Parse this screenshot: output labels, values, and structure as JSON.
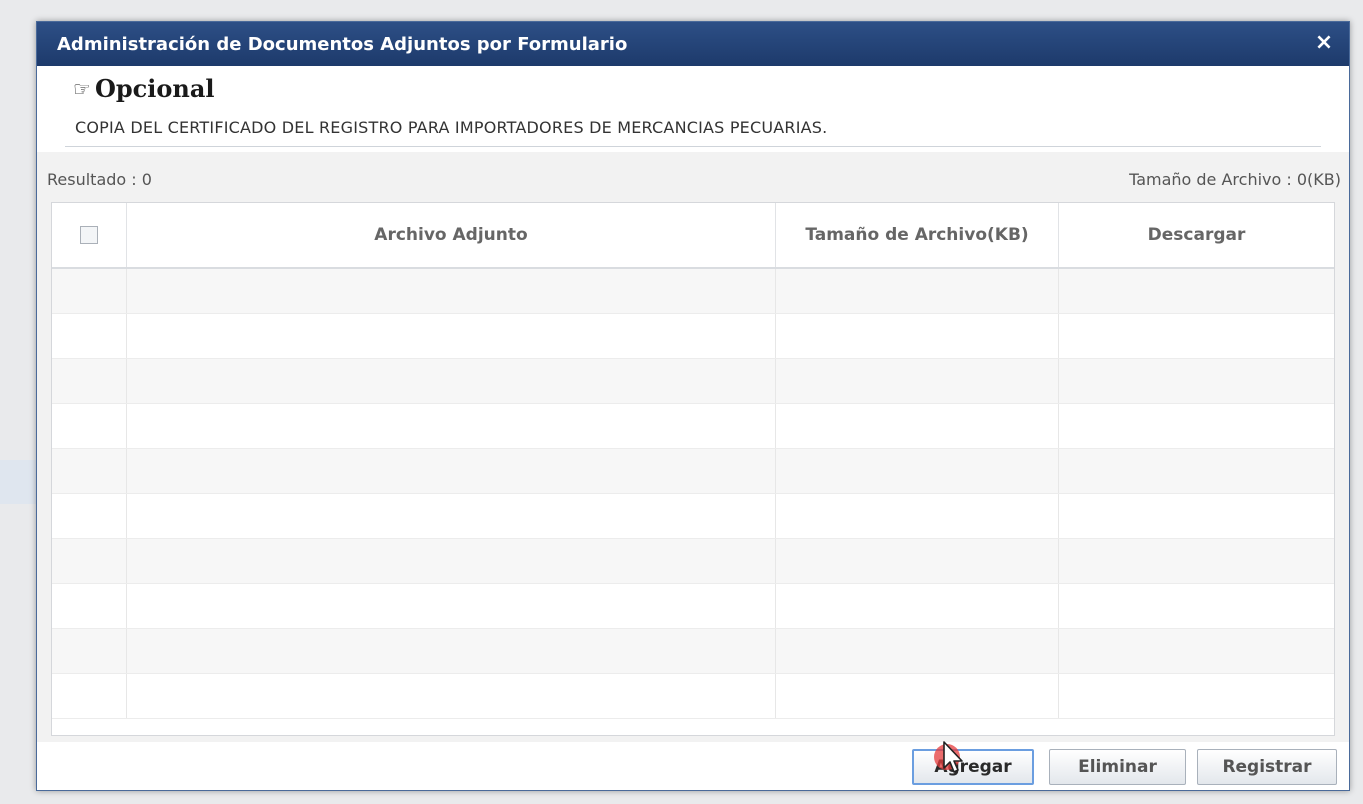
{
  "dialog": {
    "title": "Administración de Documentos Adjuntos por Formulario",
    "close_symbol": "×",
    "heading_icon": "☞",
    "heading": "Opcional",
    "description": "COPIA DEL CERTIFICADO DEL REGISTRO PARA IMPORTADORES DE MERCANCIAS PECUARIAS."
  },
  "summary": {
    "resultado": "Resultado : 0",
    "tamano_total": "Tamaño de Archivo : 0(KB)"
  },
  "table": {
    "columns": [
      "Archivo Adjunto",
      "Tamaño de Archivo(KB)",
      "Descargar"
    ],
    "rows": []
  },
  "buttons": {
    "agregar": "Agregar",
    "eliminar": "Eliminar",
    "registrar": "Registrar"
  },
  "icons": {
    "heading": "pointing-hand-icon",
    "close": "close-icon",
    "cursor": "mouse-pointer-icon"
  },
  "colors": {
    "titlebar": "#1d3a6b",
    "accent_button_border": "#6b9ee0",
    "click_indicator": "#e63c3c"
  }
}
